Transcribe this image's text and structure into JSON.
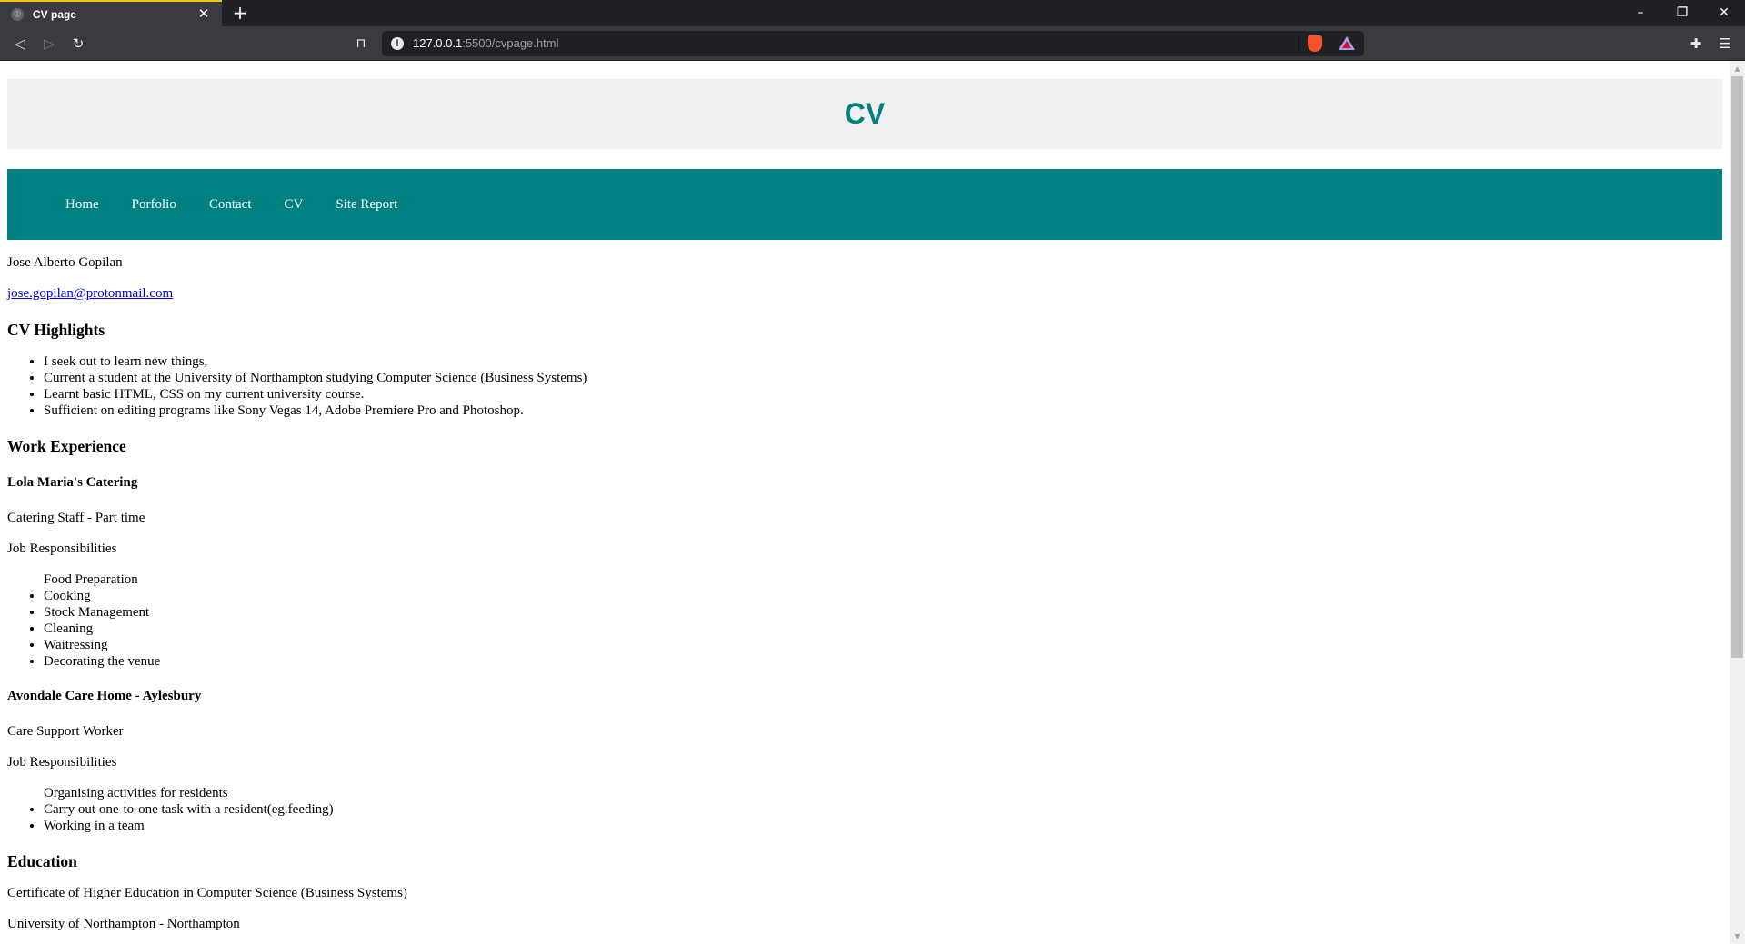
{
  "browser": {
    "tab_title": "CV page",
    "new_tab_glyph": "+",
    "url_host": "127.0.0.1",
    "url_path": ":5500/cvpage.html",
    "window_controls": [
      "–",
      "❐",
      "✕"
    ]
  },
  "header": {
    "title": "CV"
  },
  "nav": {
    "items": [
      {
        "label": "Home"
      },
      {
        "label": "Porfolio"
      },
      {
        "label": "Contact"
      },
      {
        "label": "CV"
      },
      {
        "label": "Site Report"
      }
    ]
  },
  "profile": {
    "name": "Jose Alberto Gopilan",
    "email": "jose.gopilan@protonmail.com"
  },
  "highlights": {
    "heading": "CV Highlights",
    "items": [
      "I seek out to learn new things,",
      "Current a student at the University of Northampton studying Computer Science (Business Systems)",
      "Learnt basic HTML, CSS on my current university course.",
      "Sufficient on editing programs like Sony Vegas 14, Adobe Premiere Pro and Photoshop."
    ]
  },
  "work": {
    "heading": "Work Experience",
    "jobs": [
      {
        "employer": "Lola Maria's Catering",
        "role": "Catering Staff - Part time",
        "resp_label": "Job Responsibilities",
        "responsibilities": [
          "Food Preparation",
          "Cooking",
          "Stock Management",
          "Cleaning",
          "Waitressing",
          "Decorating the venue"
        ]
      },
      {
        "employer": "Avondale Care Home - Aylesbury",
        "role": "Care Support Worker",
        "resp_label": "Job Responsibilities",
        "responsibilities": [
          "Organising activities for residents",
          "Carry out one-to-one task with a resident(eg.feeding)",
          "Working in a team"
        ]
      }
    ]
  },
  "education": {
    "heading": "Education",
    "qualification": "Certificate of Higher Education in Computer Science (Business Systems)",
    "institution": "University of Northampton - Northampton"
  }
}
